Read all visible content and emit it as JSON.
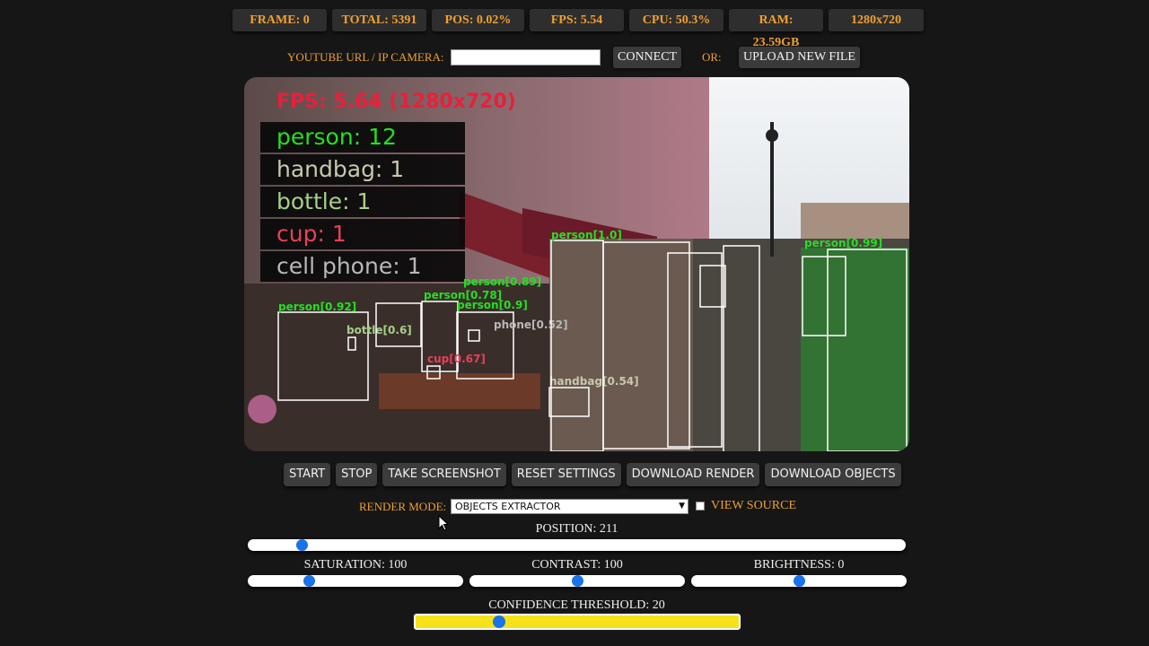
{
  "stats": {
    "frame": "FRAME: 0",
    "total": "TOTAL: 5391",
    "pos": "POS: 0.02%",
    "fps": "FPS: 5.54",
    "cpu": "CPU: 50.3%",
    "ram": "RAM: 23.59GB",
    "resolution": "1280x720"
  },
  "source": {
    "url_label": "YOUTUBE URL / IP CAMERA:",
    "url_value": "",
    "connect_label": "CONNECT",
    "or_label": "OR:",
    "upload_label": "UPLOAD NEW FILE"
  },
  "overlay": {
    "fps_text": "FPS: 5.64 (1280x720)",
    "counts": [
      {
        "text": "person: 12",
        "color": "#22e022"
      },
      {
        "text": "handbag: 1",
        "color": "#c8c8b0"
      },
      {
        "text": "bottle: 1",
        "color": "#a6d088"
      },
      {
        "text": "cup: 1",
        "color": "#e8405a"
      },
      {
        "text": "cell phone: 1",
        "color": "#b8b8b8"
      }
    ],
    "detections": [
      {
        "label": "person[0.92]",
        "color": "#22e022"
      },
      {
        "label": "bottle[0.6]",
        "color": "#a6d088"
      },
      {
        "label": "person[0.89]",
        "color": "#22e022"
      },
      {
        "label": "person[0.78]",
        "color": "#22e022"
      },
      {
        "label": "person[0.9]",
        "color": "#22e022"
      },
      {
        "label": "phone[0.52]",
        "color": "#b8b8b8"
      },
      {
        "label": "cup[0.67]",
        "color": "#e8405a"
      },
      {
        "label": "handbag[0.54]",
        "color": "#c8c8b0"
      },
      {
        "label": "person[1.0]",
        "color": "#22e022"
      },
      {
        "label": "person[0.99]",
        "color": "#22e022"
      }
    ]
  },
  "controls": {
    "start": "START",
    "stop": "STOP",
    "screenshot": "TAKE SCREENSHOT",
    "reset": "RESET SETTINGS",
    "download_render": "DOWNLOAD RENDER",
    "download_objects": "DOWNLOAD OBJECTS"
  },
  "render": {
    "mode_label": "RENDER MODE:",
    "mode_value": "OBJECTS EXTRACTOR",
    "view_source_label": "VIEW SOURCE",
    "view_source_checked": false
  },
  "sliders": {
    "position": {
      "label": "POSITION: 211",
      "value": 211,
      "min": 0,
      "max": 5391
    },
    "saturation": {
      "label": "SATURATION: 100",
      "value": 100,
      "min": 0,
      "max": 500
    },
    "contrast": {
      "label": "CONTRAST: 100",
      "value": 100,
      "min": 0,
      "max": 200
    },
    "brightness": {
      "label": "BRIGHTNESS: 0",
      "value": 0,
      "min": -100,
      "max": 100
    },
    "confidence": {
      "label": "CONFIDENCE THRESHOLD: 20",
      "value": 20,
      "min": 0,
      "max": 100
    }
  },
  "colors": {
    "accent": "#f0a030",
    "slider_thumb": "#1a73e8",
    "confidence_track": "#f6e21b",
    "fps_overlay": "#e8203a"
  }
}
